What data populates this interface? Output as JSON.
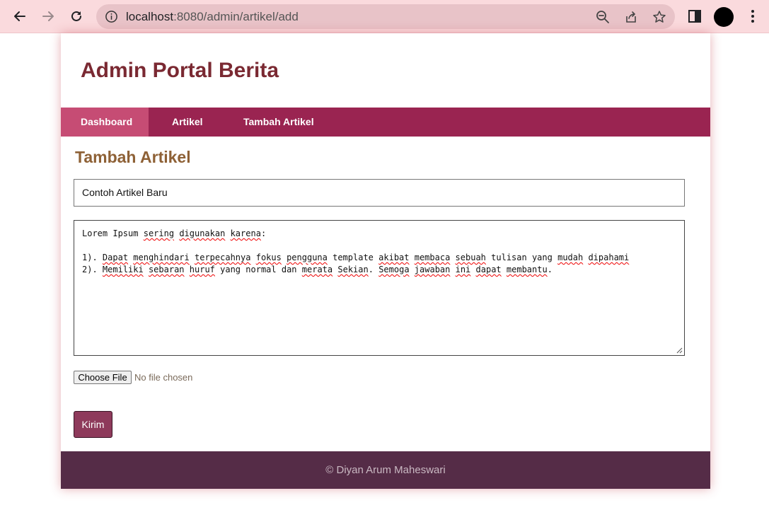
{
  "browser": {
    "url_host": "localhost",
    "url_path": ":8080/admin/artikel/add"
  },
  "site": {
    "title": "Admin Portal Berita"
  },
  "menu": {
    "items": [
      {
        "label": "Dashboard",
        "active": true
      },
      {
        "label": "Artikel",
        "active": false
      },
      {
        "label": "Tambah Artikel",
        "active": false
      }
    ]
  },
  "form": {
    "heading": "Tambah Artikel",
    "title_value": "Contoh Artikel Baru",
    "content_lines": [
      "Lorem Ipsum sering digunakan karena:",
      "",
      "1). Dapat menghindari terpecahnya fokus pengguna template akibat membaca sebuah tulisan yang mudah dipahami",
      "2). Memiliki sebaran huruf yang normal dan merata Sekian. Semoga jawaban ini dapat membantu."
    ],
    "file_button_label": "Choose File",
    "file_status": "No file chosen",
    "submit_label": "Kirim"
  },
  "footer": {
    "text": "© Diyan Arum Maheswari"
  },
  "colors": {
    "chrome_bg": "#fadadd",
    "title": "#7a2932",
    "menu_bg": "#9a2451",
    "menu_active": "#c64c74",
    "heading": "#8e6136",
    "submit_bg": "#8e3a5b",
    "footer_bg": "#552c47"
  }
}
